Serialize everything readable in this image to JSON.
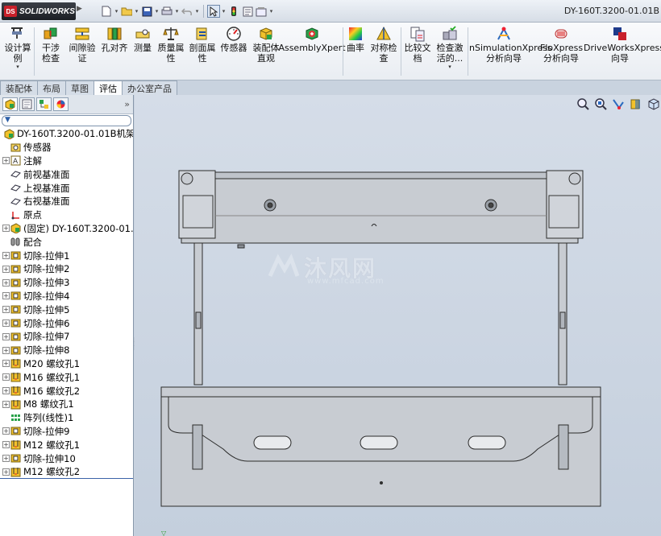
{
  "app": {
    "brand": "SOLIDWORKS",
    "document_title": "DY-160T.3200-01.01B"
  },
  "quick_access": [
    "new-icon",
    "open-icon",
    "save-icon",
    "print-icon",
    "undo-icon",
    "select-icon",
    "rebuild-icon",
    "file-properties-icon",
    "options-icon"
  ],
  "toolbar": {
    "design_study": "设计算例",
    "interference_check": "干涉检查",
    "clearance_verification": "间隙验证",
    "hole_alignment": "孔对齐",
    "measure": "测量",
    "mass_properties": "质量属性",
    "section_properties": "剖面属性",
    "sensor": "传感器",
    "assembly_visualization": "装配体直观",
    "assemblyxpert": "AssemblyXpert",
    "curvature": "曲率",
    "symmetry_check": "对称检查",
    "compare_documents": "比较文档",
    "check_active": "检查激活的...",
    "simulationxpress": "nSimulationXpress分析向导",
    "floxpress": "FloXpress分析向导",
    "driveworksxpress": "DriveWorksXpress向导"
  },
  "tabs": [
    {
      "label": "装配体",
      "active": false
    },
    {
      "label": "布局",
      "active": false
    },
    {
      "label": "草图",
      "active": false
    },
    {
      "label": "评估",
      "active": true
    },
    {
      "label": "办公室产品",
      "active": false
    }
  ],
  "tree": {
    "root": "DY-160T.3200-01.01B机架",
    "items": [
      {
        "label": "传感器",
        "icon": "sensor-icon",
        "expandable": false
      },
      {
        "label": "注解",
        "icon": "annotation-icon",
        "expandable": true
      },
      {
        "label": "前视基准面",
        "icon": "plane-icon",
        "expandable": false
      },
      {
        "label": "上视基准面",
        "icon": "plane-icon",
        "expandable": false
      },
      {
        "label": "右视基准面",
        "icon": "plane-icon",
        "expandable": false
      },
      {
        "label": "原点",
        "icon": "origin-icon",
        "expandable": false
      },
      {
        "label": "(固定) DY-160T.3200-01.",
        "icon": "part-icon",
        "expandable": true
      },
      {
        "label": "配合",
        "icon": "mates-icon",
        "expandable": false
      },
      {
        "label": "切除-拉伸1",
        "icon": "cut-extrude-icon",
        "expandable": true
      },
      {
        "label": "切除-拉伸2",
        "icon": "cut-extrude-icon",
        "expandable": true
      },
      {
        "label": "切除-拉伸3",
        "icon": "cut-extrude-icon",
        "expandable": true
      },
      {
        "label": "切除-拉伸4",
        "icon": "cut-extrude-icon",
        "expandable": true
      },
      {
        "label": "切除-拉伸5",
        "icon": "cut-extrude-icon",
        "expandable": true
      },
      {
        "label": "切除-拉伸6",
        "icon": "cut-extrude-icon",
        "expandable": true
      },
      {
        "label": "切除-拉伸7",
        "icon": "cut-extrude-icon",
        "expandable": true
      },
      {
        "label": "切除-拉伸8",
        "icon": "cut-extrude-icon",
        "expandable": true
      },
      {
        "label": "M20 螺纹孔1",
        "icon": "hole-wizard-icon",
        "expandable": true
      },
      {
        "label": "M16 螺纹孔1",
        "icon": "hole-wizard-icon",
        "expandable": true
      },
      {
        "label": "M16 螺纹孔2",
        "icon": "hole-wizard-icon",
        "expandable": true
      },
      {
        "label": "M8 螺纹孔1",
        "icon": "hole-wizard-icon",
        "expandable": true
      },
      {
        "label": "阵列(线性)1",
        "icon": "linear-pattern-icon",
        "expandable": false
      },
      {
        "label": "切除-拉伸9",
        "icon": "cut-extrude-icon",
        "expandable": true
      },
      {
        "label": "M12 螺纹孔1",
        "icon": "hole-wizard-icon",
        "expandable": true
      },
      {
        "label": "切除-拉伸10",
        "icon": "cut-extrude-icon",
        "expandable": true
      },
      {
        "label": "M12 螺纹孔2",
        "icon": "hole-wizard-icon",
        "expandable": true
      }
    ]
  },
  "watermark": {
    "text": "沐风网",
    "url": "www.mfcad.com"
  }
}
